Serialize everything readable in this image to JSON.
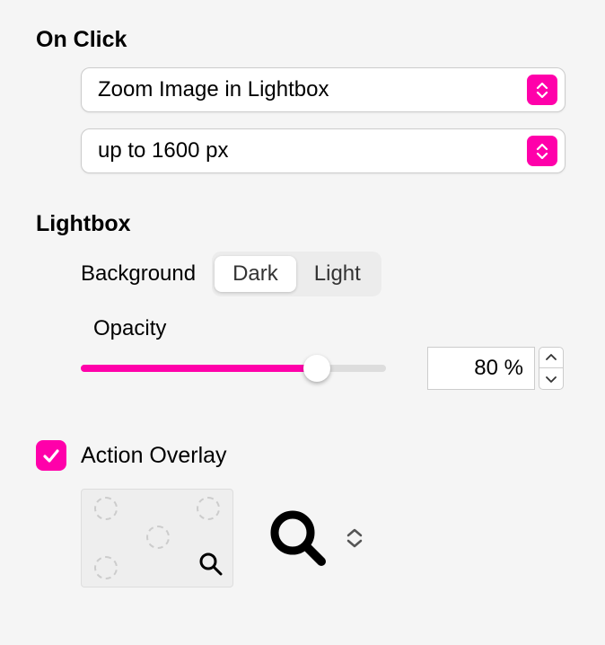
{
  "onClick": {
    "title": "On Click",
    "action": "Zoom Image in Lightbox",
    "size": "up to 1600 px"
  },
  "lightbox": {
    "title": "Lightbox",
    "backgroundLabel": "Background",
    "backgroundOptions": {
      "dark": "Dark",
      "light": "Light"
    },
    "backgroundSelected": "Dark",
    "opacityLabel": "Opacity",
    "opacityValue": "80 %",
    "opacityPercent": 80
  },
  "actionOverlay": {
    "label": "Action Overlay",
    "checked": true,
    "iconName": "magnifier"
  }
}
